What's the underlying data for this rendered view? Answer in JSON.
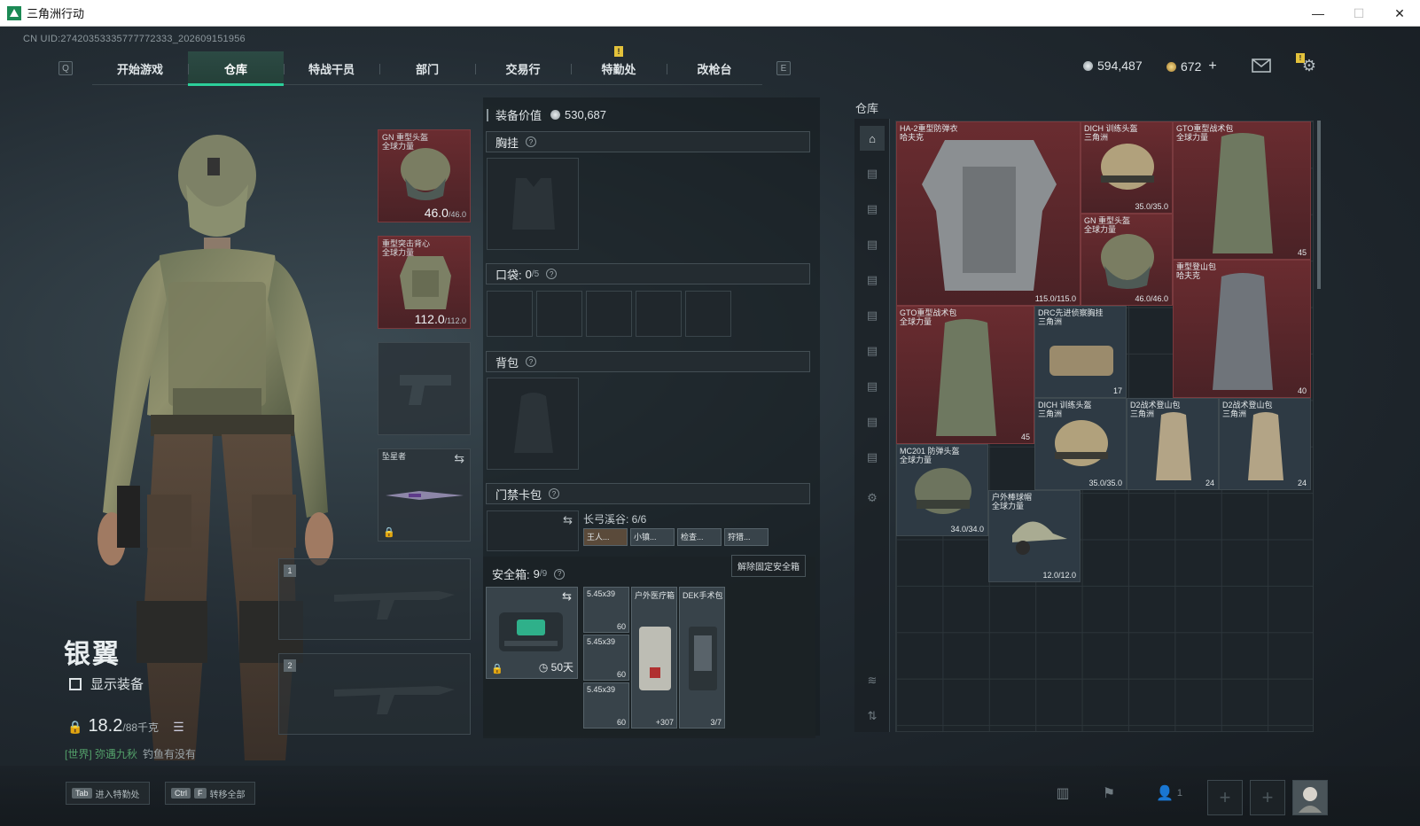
{
  "window": {
    "title": "三角洲行动",
    "minimize": "—",
    "maximize": "☐",
    "close": "✕"
  },
  "uid": "CN UID:2742035333577777233​3_202609151956",
  "nav": {
    "left_key": "Q",
    "right_key": "E",
    "tabs": [
      "开始游戏",
      "仓库",
      "特战干员",
      "部门",
      "交易行",
      "特勤处",
      "改枪台"
    ],
    "active_tab": "仓库",
    "alert_mark": "!"
  },
  "currency": {
    "silver": "594,487",
    "gold": "672",
    "gold_add": "+"
  },
  "mail_badge": "!",
  "character": {
    "name": "银翼",
    "show_equipment_label": "显示装备",
    "weight_current": "18.2",
    "weight_max": "/88千克",
    "chat_channel": "[世界] 弥遇九秋",
    "chat_message": "钓鱼有没有"
  },
  "gear": {
    "helmet": {
      "label": "GN 重型头盔\n全球力量",
      "value": "46.0",
      "max": "/46.0"
    },
    "armor": {
      "label": "重型突击背心\n全球力量",
      "value": "112.0",
      "max": "/112.0"
    },
    "melee": {
      "label": "坠星者"
    },
    "weapon_slot_1": "1",
    "weapon_slot_2": "2"
  },
  "equipment": {
    "value_label": "装备价值",
    "value": "530,687",
    "chest_rig": "胸挂",
    "pocket_label": "口袋:",
    "pocket_count": "0",
    "pocket_max": "/5",
    "backpack": "背包",
    "keycard": "门禁卡包",
    "keycard_name": "长弓溪谷: 6/6",
    "keycard_rooms": [
      "王人...",
      "小镇...",
      "检查...",
      "狩猎..."
    ],
    "safebox_label": "安全箱:",
    "safebox_count": "9",
    "safebox_max": "/9",
    "unlock_tooltip": "解除固定安全箱",
    "safebox_days": "50天",
    "safebox_items": [
      {
        "label": "5.45x39",
        "val": "60"
      },
      {
        "label": "5.45x39",
        "val": "60"
      },
      {
        "label": "5.45x39",
        "val": "60"
      },
      {
        "label": "户外医疗箱",
        "val": "+307"
      },
      {
        "label": "DEK手术包",
        "val": "3/7"
      }
    ]
  },
  "warehouse": {
    "title": "仓库",
    "items": [
      {
        "label": "HA-2重型防弹衣\n哈夫克",
        "val": "115.0/115.0"
      },
      {
        "label": "DICH 训练头盔\n三角洲",
        "val": "35.0/35.0"
      },
      {
        "label": "GTO重型战术包\n全球力量",
        "val": "45"
      },
      {
        "label": "GN 重型头盔\n全球力量",
        "val": "46.0/46.0"
      },
      {
        "label": "重型登山包\n哈夫克",
        "val": "40"
      },
      {
        "label": "GTO重型战术包\n全球力量",
        "val": "45"
      },
      {
        "label": "DRC先进侦察胸挂\n三角洲",
        "val": "17"
      },
      {
        "label": "DICH 训练头盔\n三角洲",
        "val": "35.0/35.0"
      },
      {
        "label": "D2战术登山包\n三角洲",
        "val": "24"
      },
      {
        "label": "D2战术登山包\n三角洲",
        "val": "24"
      },
      {
        "label": "MC201 防弹头盔\n全球力量",
        "val": "34.0/34.0"
      },
      {
        "label": "户外棒球帽\n全球力量",
        "val": "12.0/12.0"
      }
    ]
  },
  "bottom": {
    "hint1_key": "Tab",
    "hint1_label": "进入特勤处",
    "hint2_key1": "Ctrl",
    "hint2_key2": "F",
    "hint2_label": "转移全部",
    "squad_count": "1"
  }
}
